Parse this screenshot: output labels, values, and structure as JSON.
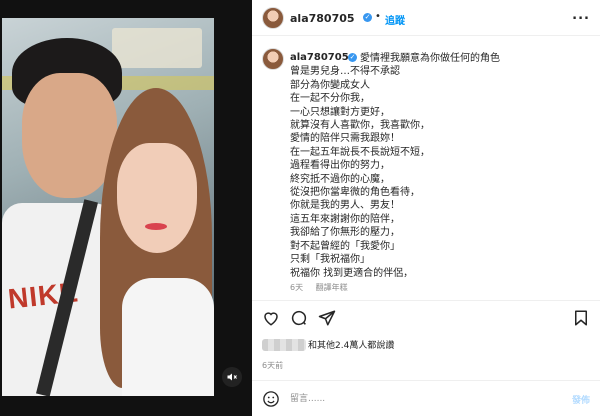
{
  "post": {
    "username": "ala780705",
    "follow_label": "追蹤",
    "more_label": "...",
    "separator": "•",
    "caption_lines": [
      "愛情裡我願意為你做任何的角色",
      "曾是男兒身…不得不承認",
      "部分為你變成女人",
      "在一起不分你我，",
      "一心只想讓對方更好，",
      "就算沒有人喜歡你，我喜歡你，",
      "愛情的陪伴只需我跟妳！",
      "在一起五年說長不長說短不短，",
      "過程看得出你的努力，",
      "終究抵不過你的心魔，",
      "從沒把你當卑微的角色看待，",
      "你就是我的男人、男友！",
      "這五年來謝謝你的陪伴，",
      "我卻給了你無形的壓力，",
      "對不起曾經的「我愛你」",
      "只剩「我祝福你」",
      "祝福你 找到更適合的伴侶，"
    ],
    "caption_age": "6天",
    "translate_label": "翻譯年糕",
    "likes_text": "和其他2.4萬人都說讚",
    "time_label": "6天前",
    "comment_placeholder": "留言......",
    "post_label": "發佈"
  },
  "icons": {
    "verified": "verified-badge-icon",
    "like": "heart-icon",
    "comment": "comment-icon",
    "share": "send-icon",
    "save": "bookmark-icon",
    "emoji": "emoji-icon",
    "mute": "speaker-muted-icon"
  },
  "colors": {
    "accent": "#0095f6",
    "verified": "#3897f0",
    "muted_text": "#8e8e8e",
    "post_disabled": "#b3dbff"
  }
}
